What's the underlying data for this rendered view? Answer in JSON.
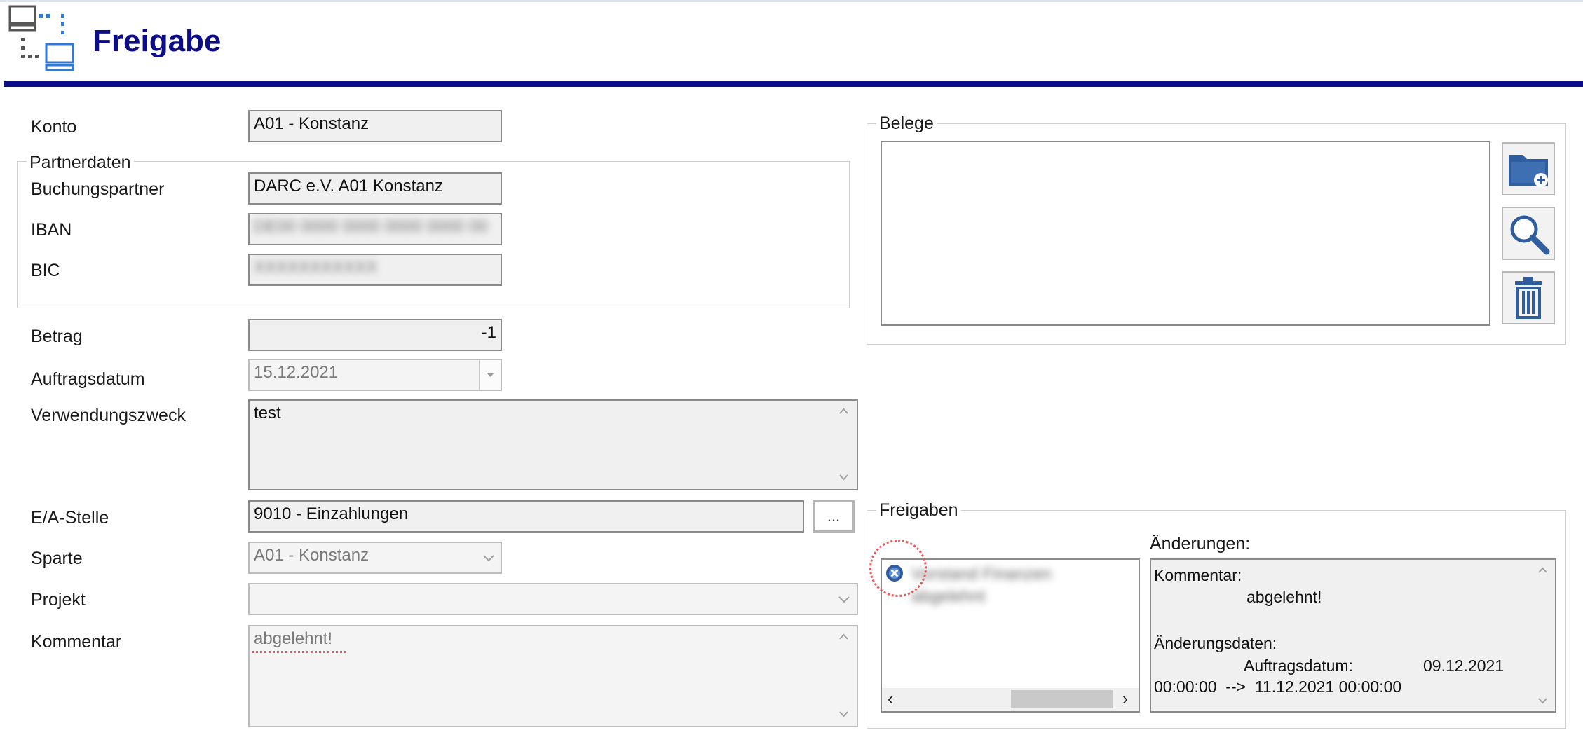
{
  "header": {
    "title": "Freigabe",
    "icon": "network-computers-icon",
    "accent_color": "#0c0c86"
  },
  "form": {
    "konto": {
      "label": "Konto",
      "value": "A01 - Konstanz"
    },
    "partnerdaten": {
      "legend": "Partnerdaten",
      "buchungspartner": {
        "label": "Buchungspartner",
        "value": "DARC e.V. A01 Konstanz"
      },
      "iban": {
        "label": "IBAN",
        "value": "DE00 0000 0000 0000 0000 00"
      },
      "bic": {
        "label": "BIC",
        "value": "XXXXXXXXXXX"
      }
    },
    "betrag": {
      "label": "Betrag",
      "value": "-1"
    },
    "auftragsdatum": {
      "label": "Auftragsdatum",
      "value": "15.12.2021"
    },
    "verwendungszweck": {
      "label": "Verwendungszweck",
      "value": "test"
    },
    "ea_stelle": {
      "label": "E/A-Stelle",
      "value": "9010 - Einzahlungen",
      "button": "..."
    },
    "sparte": {
      "label": "Sparte",
      "value": "A01 - Konstanz"
    },
    "projekt": {
      "label": "Projekt",
      "value": ""
    },
    "kommentar": {
      "label": "Kommentar",
      "value": "abgelehnt!"
    }
  },
  "belege": {
    "legend": "Belege",
    "buttons": [
      "folder-add-icon",
      "magnifier-icon",
      "trash-icon"
    ]
  },
  "freigaben": {
    "legend": "Freigaben",
    "list_item": "Vorstand Finanzen",
    "list_item_sub": "abgelehnt",
    "aenderungen_label": "Änderungen:",
    "details": {
      "kommentar_label": "Kommentar:",
      "kommentar_value": "abgelehnt!",
      "aenderungsdaten_label": "Änderungsdaten:",
      "auftragsdatum_label": "Auftragsdatum:",
      "auftragsdatum_old": "09.12.2021",
      "change_line": "00:00:00  -->  11.12.2021 00:00:00"
    }
  }
}
